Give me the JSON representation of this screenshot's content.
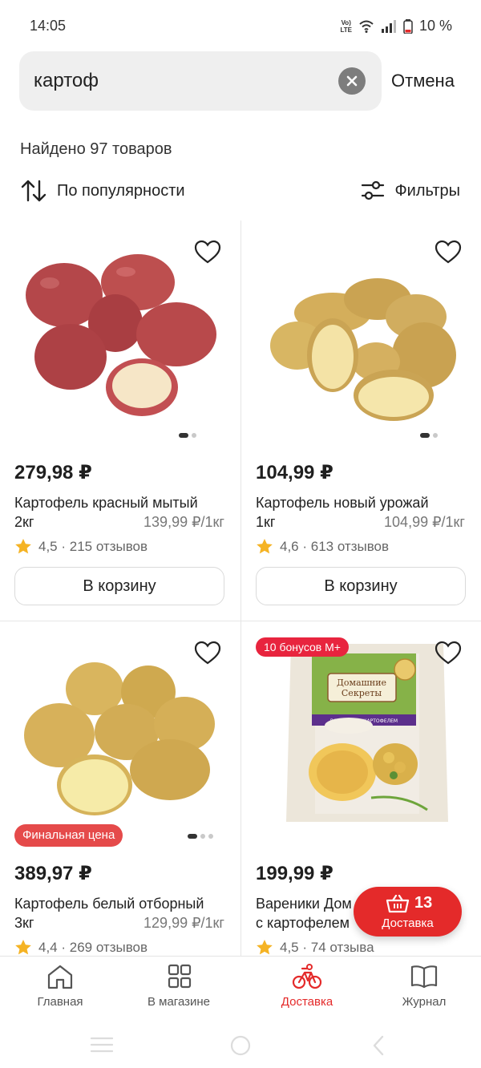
{
  "status_bar": {
    "time": "14:05",
    "network": "VoLTE",
    "battery": "10 %"
  },
  "search": {
    "value": "картоф",
    "cancel_label": "Отмена"
  },
  "results": {
    "count_text": "Найдено 97 товаров"
  },
  "sort": {
    "label": "По популярности"
  },
  "filters": {
    "label": "Фильтры"
  },
  "products": [
    {
      "price": "279,98 ₽",
      "title": "Картофель красный мытый",
      "weight": "2кг",
      "unit_price": "139,99 ₽/1кг",
      "rating": "4,5 · 215 отзывов",
      "cart_label": "В корзину"
    },
    {
      "price": "104,99 ₽",
      "title": "Картофель новый урожай",
      "weight": "1кг",
      "unit_price": "104,99 ₽/1кг",
      "rating": "4,6 · 613 отзывов",
      "cart_label": "В корзину"
    },
    {
      "price": "389,97 ₽",
      "title": "Картофель белый отборный",
      "weight": "3кг",
      "unit_price": "129,99 ₽/1кг",
      "rating": "4,4 · 269 отзывов",
      "badge": "Финальная цена"
    },
    {
      "price": "199,99 ₽",
      "title": "Вареники Дом",
      "title_line2": "с картофелем",
      "rating": "4,5 · 74 отзыва",
      "bonus_badge": "10 бонусов M+",
      "package_brand_line1": "Домашние",
      "package_brand_line2": "Секреты",
      "package_label": "ВАРЕНИКИ С КАРТОФЕЛЕМ"
    }
  ],
  "floating_cart": {
    "count": "13",
    "label": "Доставка"
  },
  "bottom_nav": [
    {
      "label": "Главная",
      "icon": "home-icon"
    },
    {
      "label": "В магазине",
      "icon": "grid-icon"
    },
    {
      "label": "Доставка",
      "icon": "bicycle-icon",
      "active": true
    },
    {
      "label": "Журнал",
      "icon": "book-icon"
    }
  ],
  "colors": {
    "accent": "#e42a2a",
    "bonus": "#e8243e",
    "final_price_badge": "#e54a4a",
    "star": "#f5b324"
  }
}
